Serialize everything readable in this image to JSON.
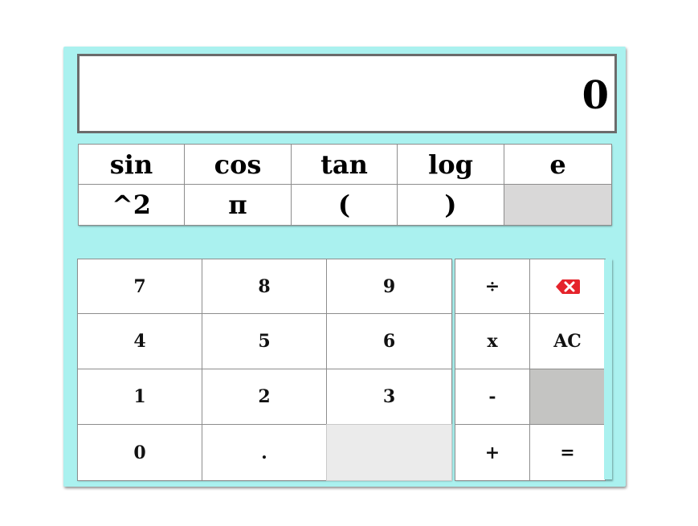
{
  "display": {
    "value": "0"
  },
  "scientific_keys": [
    {
      "label": "sin"
    },
    {
      "label": "cos"
    },
    {
      "label": "tan"
    },
    {
      "label": "log"
    },
    {
      "label": "e"
    },
    {
      "label": "^2"
    },
    {
      "label": "π"
    },
    {
      "label": "("
    },
    {
      "label": ")"
    }
  ],
  "number_keys": [
    {
      "label": "7"
    },
    {
      "label": "8"
    },
    {
      "label": "9"
    },
    {
      "label": "4"
    },
    {
      "label": "5"
    },
    {
      "label": "6"
    },
    {
      "label": "1"
    },
    {
      "label": "2"
    },
    {
      "label": "3"
    },
    {
      "label": "0"
    },
    {
      "label": "."
    }
  ],
  "operator_keys": {
    "divide": "÷",
    "backspace_icon": "backspace-icon",
    "multiply": "x",
    "clear": "AC",
    "minus": "-",
    "plus": "+",
    "equals": "="
  },
  "colors": {
    "panel": "#aaf1ef",
    "key": "#ffffff",
    "key_border": "#8d8d8d",
    "backspace_icon": "#e5232b"
  }
}
